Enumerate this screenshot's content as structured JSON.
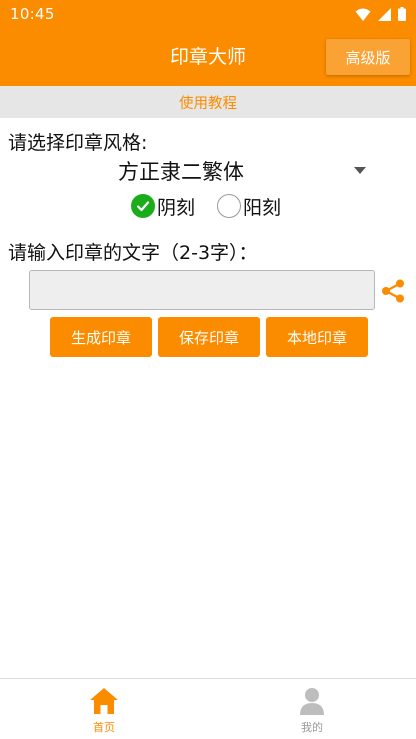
{
  "status_bar": {
    "time": "10:45"
  },
  "app_bar": {
    "title": "印章大师",
    "premium_label": "高级版"
  },
  "tutorial": {
    "label": "使用教程"
  },
  "style_section": {
    "label": "请选择印章风格:",
    "selected_style": "方正隶二繁体",
    "radios": [
      {
        "label": "阴刻",
        "checked": true
      },
      {
        "label": "阳刻",
        "checked": false
      }
    ]
  },
  "text_section": {
    "label": "请输入印章的文字（2-3字）：",
    "input_value": "",
    "input_placeholder": ""
  },
  "actions": {
    "generate_label": "生成印章",
    "save_label": "保存印章",
    "local_label": "本地印章"
  },
  "bottom_nav": {
    "tabs": [
      {
        "label": "首页",
        "icon": "home-icon",
        "active": true
      },
      {
        "label": "我的",
        "icon": "person-icon",
        "active": false
      }
    ]
  },
  "colors": {
    "primary": "#fb8c00",
    "radio_checked": "#1aad19",
    "tutorial_bg": "#e6e6e6"
  }
}
